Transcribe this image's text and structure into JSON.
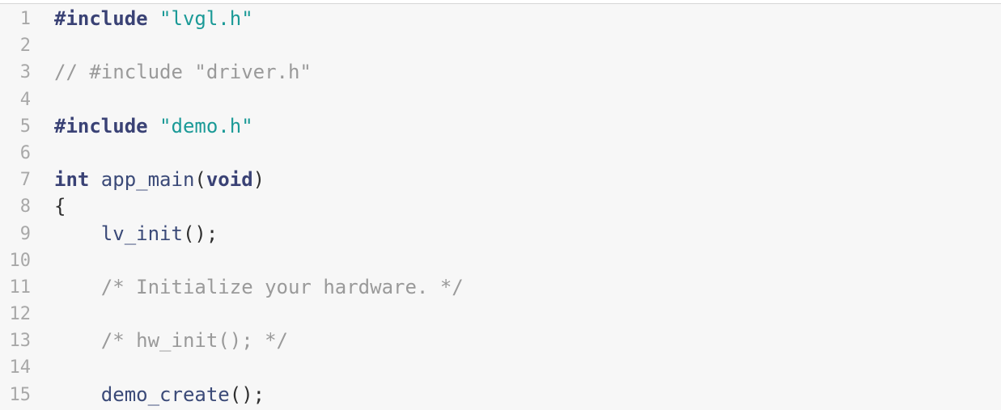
{
  "editor": {
    "language": "c",
    "lines": [
      {
        "number": "1",
        "tokens": [
          {
            "type": "keyword",
            "text": "#include"
          },
          {
            "type": "plain",
            "text": " "
          },
          {
            "type": "string",
            "text": "\"lvgl.h\""
          }
        ]
      },
      {
        "number": "2",
        "tokens": []
      },
      {
        "number": "3",
        "tokens": [
          {
            "type": "comment",
            "text": "// #include \"driver.h\""
          }
        ]
      },
      {
        "number": "4",
        "tokens": []
      },
      {
        "number": "5",
        "tokens": [
          {
            "type": "keyword",
            "text": "#include"
          },
          {
            "type": "plain",
            "text": " "
          },
          {
            "type": "string",
            "text": "\"demo.h\""
          }
        ]
      },
      {
        "number": "6",
        "tokens": []
      },
      {
        "number": "7",
        "tokens": [
          {
            "type": "keyword",
            "text": "int"
          },
          {
            "type": "plain",
            "text": " app_main"
          },
          {
            "type": "punct",
            "text": "("
          },
          {
            "type": "keyword",
            "text": "void"
          },
          {
            "type": "punct",
            "text": ")"
          }
        ]
      },
      {
        "number": "8",
        "tokens": [
          {
            "type": "punct",
            "text": "{"
          }
        ]
      },
      {
        "number": "9",
        "tokens": [
          {
            "type": "plain",
            "text": "    lv_init"
          },
          {
            "type": "punct",
            "text": "();"
          }
        ]
      },
      {
        "number": "10",
        "tokens": []
      },
      {
        "number": "11",
        "tokens": [
          {
            "type": "plain",
            "text": "    "
          },
          {
            "type": "comment",
            "text": "/* Initialize your hardware. */"
          }
        ]
      },
      {
        "number": "12",
        "tokens": []
      },
      {
        "number": "13",
        "tokens": [
          {
            "type": "plain",
            "text": "    "
          },
          {
            "type": "comment",
            "text": "/* hw_init(); */"
          }
        ]
      },
      {
        "number": "14",
        "tokens": []
      },
      {
        "number": "15",
        "tokens": [
          {
            "type": "plain",
            "text": "    demo_create"
          },
          {
            "type": "punct",
            "text": "();"
          }
        ]
      }
    ],
    "colors": {
      "background": "#f7f7f7",
      "line_number": "#a8a8a8",
      "keyword": "#3a4275",
      "string": "#1b9a97",
      "comment": "#9a9a9a",
      "identifier": "#3b4a78"
    }
  }
}
